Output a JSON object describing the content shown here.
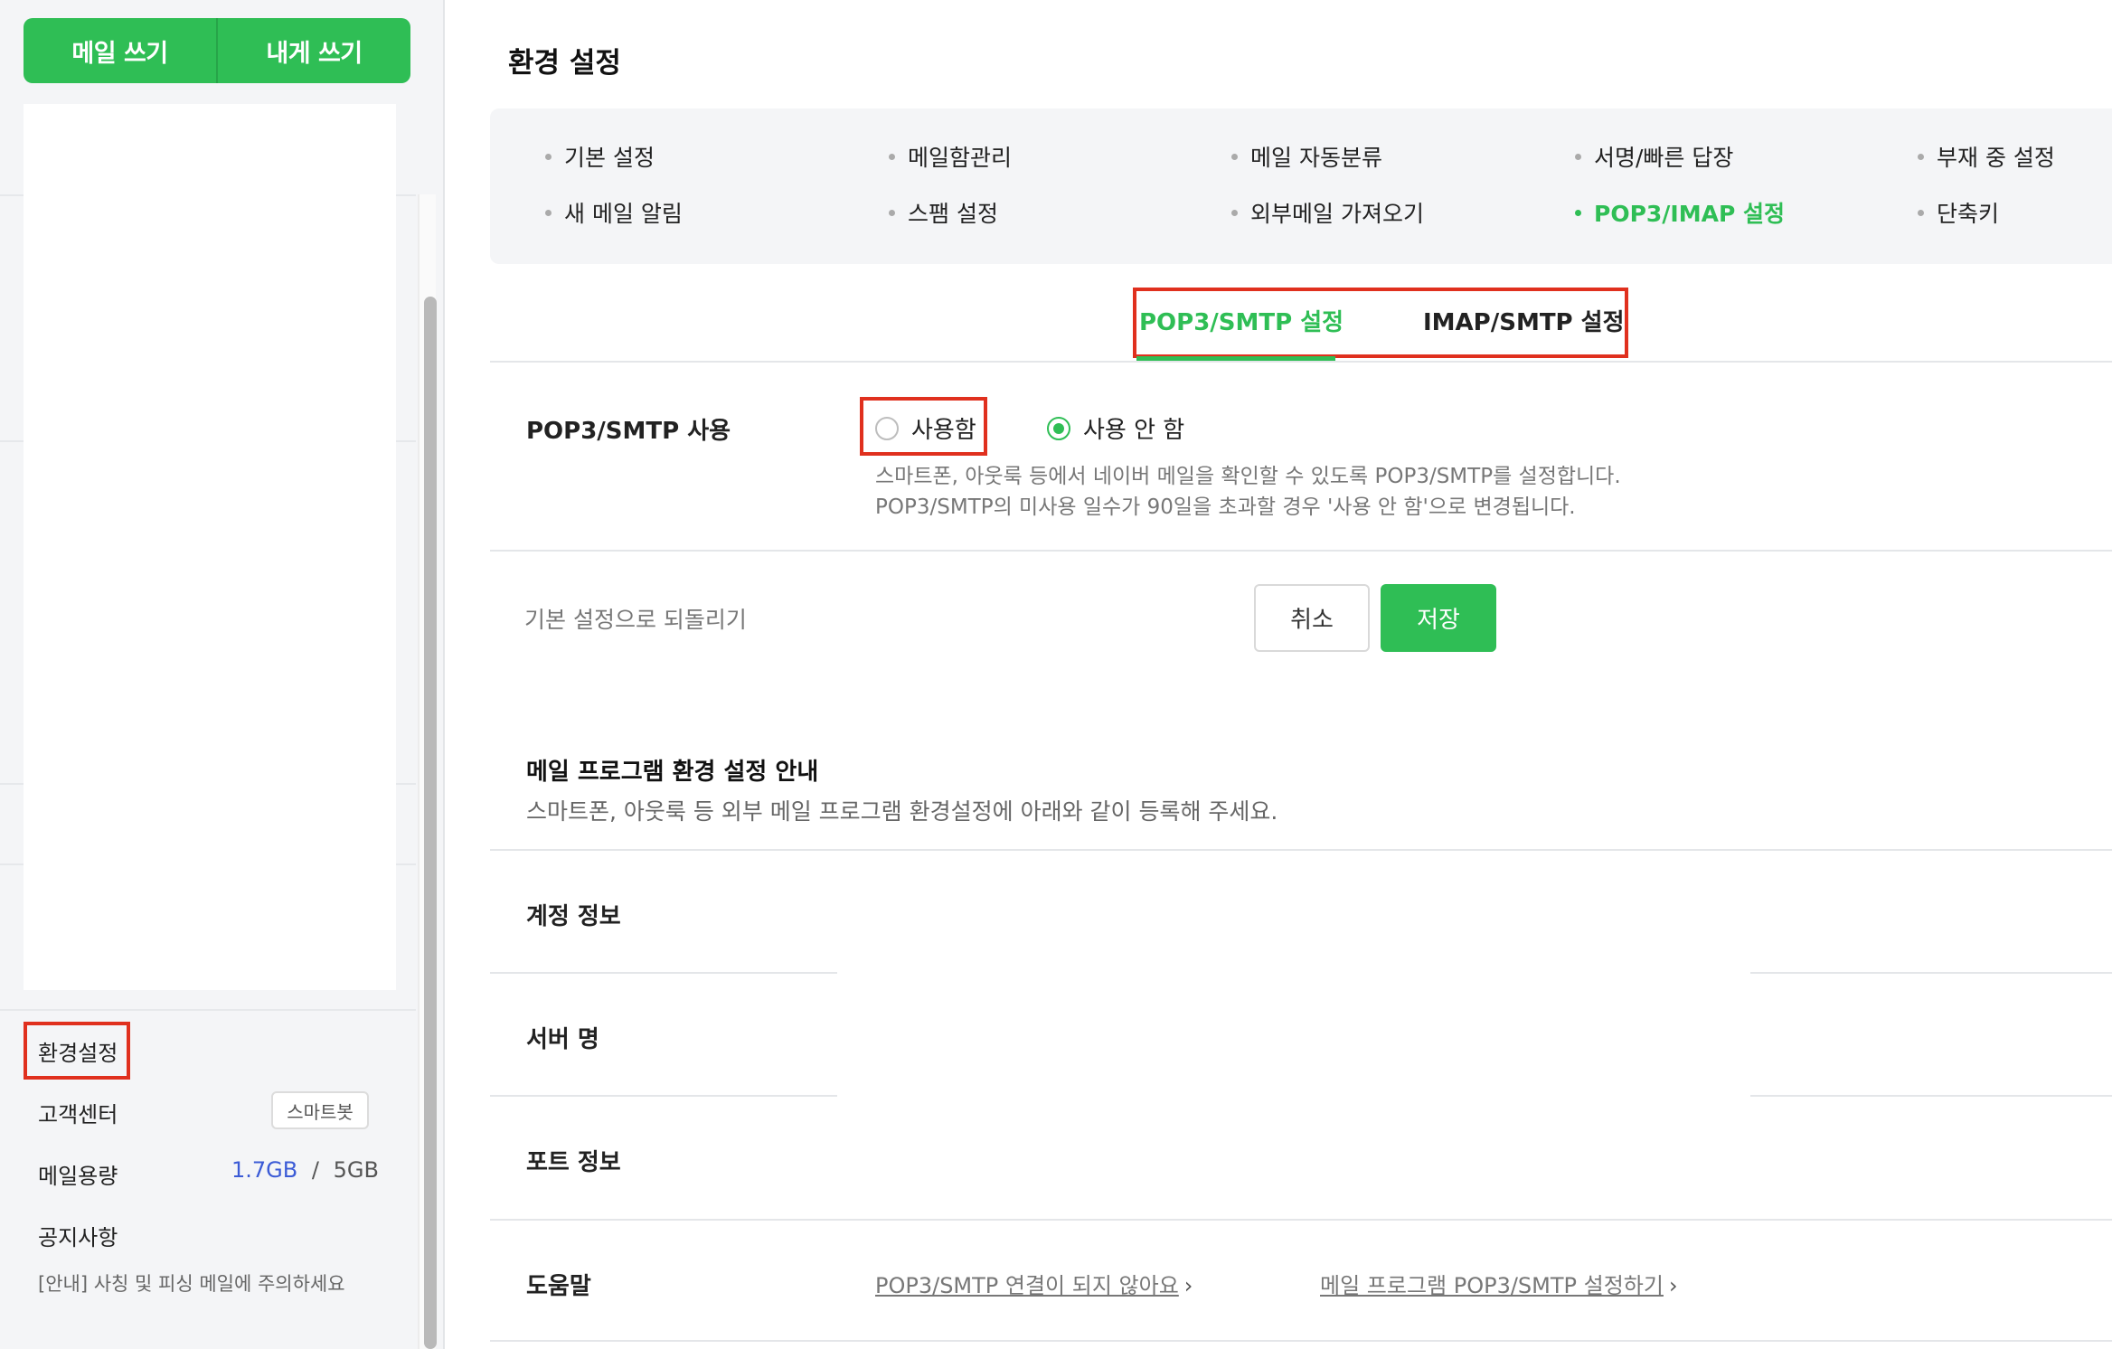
{
  "compose": {
    "write": "메일 쓰기",
    "write_self": "내게 쓰기"
  },
  "sidebar": {
    "settings": "환경설정",
    "support": "고객센터",
    "smartbot": "스마트봇",
    "storage_label": "메일용량",
    "storage_used": "1.7GB",
    "storage_sep": "/",
    "storage_total": "5GB",
    "notice_label": "공지사항",
    "notice_item": "[안내] 사칭 및 피싱 메일에 주의하세요"
  },
  "page_title": "환경 설정",
  "nav": {
    "row1": [
      "기본 설정",
      "메일함관리",
      "메일 자동분류",
      "서명/빠른 답장",
      "부재 중 설정"
    ],
    "row2": [
      "새 메일 알림",
      "스팸 설정",
      "외부메일 가져오기",
      "POP3/IMAP 설정",
      "단축키"
    ],
    "active": "POP3/IMAP 설정"
  },
  "subtabs": {
    "pop3": "POP3/SMTP 설정",
    "imap": "IMAP/SMTP 설정"
  },
  "pop3_use": {
    "label": "POP3/SMTP 사용",
    "option_on": "사용함",
    "option_off": "사용 안 함",
    "selected": "사용 안 함",
    "desc1": "스마트폰, 아웃룩 등에서 네이버 메일을 확인할 수 있도록 POP3/SMTP를 설정합니다.",
    "desc2": "POP3/SMTP의 미사용 일수가 90일을 초과할 경우 '사용 안 함'으로 변경됩니다."
  },
  "actions": {
    "reset": "기본 설정으로 되돌리기",
    "cancel": "취소",
    "save": "저장"
  },
  "guide": {
    "title": "메일 프로그램 환경 설정 안내",
    "desc": "스마트폰, 아웃룩 등 외부 메일 프로그램 환경설정에 아래와 같이 등록해 주세요.",
    "rows": [
      "계정 정보",
      "서버 명",
      "포트 정보",
      "도움말"
    ]
  },
  "help": {
    "link1": "POP3/SMTP 연결이 되지 않아요",
    "link2": "메일 프로그램 POP3/SMTP 설정하기"
  },
  "colors": {
    "accent": "#2fbe55",
    "highlight": "#e0301e",
    "link_blue": "#3b5bd6"
  }
}
